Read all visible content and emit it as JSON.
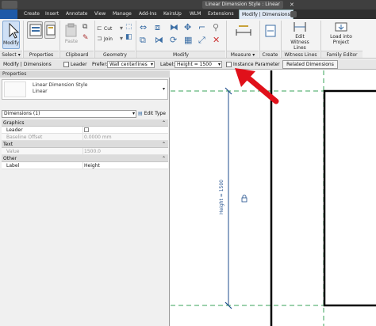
{
  "titlebar": {
    "window_title": "Linear Dimension Style : Linear",
    "close_glyph": "✕"
  },
  "tabs": [
    {
      "label": "",
      "active": false
    },
    {
      "label": "Create",
      "active": false
    },
    {
      "label": "Insert",
      "active": false
    },
    {
      "label": "Annotate",
      "active": false
    },
    {
      "label": "View",
      "active": false
    },
    {
      "label": "Manage",
      "active": false
    },
    {
      "label": "Add-Ins",
      "active": false
    },
    {
      "label": "KeirsUp",
      "active": false
    },
    {
      "label": "WLM",
      "active": false
    },
    {
      "label": "Extensions",
      "active": false
    },
    {
      "label": "Modify | Dimensions",
      "active": true
    }
  ],
  "ribbon": {
    "select": {
      "button_label": "Modify",
      "panel": "Select"
    },
    "properties": {
      "panel": "Properties"
    },
    "clipboard": {
      "paste_label": "Paste",
      "cut_label": "Cut",
      "join_label": "Join",
      "panel": "Clipboard"
    },
    "geometry": {
      "panel": "Geometry"
    },
    "modify": {
      "panel": "Modify"
    },
    "measure": {
      "panel": "Measure"
    },
    "create": {
      "panel": "Create"
    },
    "witness": {
      "button_label": "Edit Witness Lines",
      "panel": "Witness Lines"
    },
    "family": {
      "button_label": "Load into Project",
      "panel": "Family Editor"
    }
  },
  "options_bar": {
    "context": "Modify | Dimensions",
    "leader_label": "Leader",
    "prefer_label": "Prefer:",
    "prefer_value": "Wall centerlines",
    "label_label": "Label:",
    "label_value": "Height = 1500",
    "instance_parameter_label": "Instance Parameter",
    "related_button": "Related Dimensions"
  },
  "properties": {
    "header": "Properties",
    "type_family": "Linear Dimension Style",
    "type_name": "Linear",
    "instance_filter": "Dimensions (1)",
    "edit_type": "Edit Type",
    "groups": [
      {
        "name": "Graphics",
        "toggle": "⌃",
        "rows": [
          {
            "name": "Leader",
            "value": "",
            "checkbox": true,
            "readonly": false
          },
          {
            "name": "Baseline Offset",
            "value": "0.0000 mm",
            "checkbox": false,
            "readonly": true
          }
        ]
      },
      {
        "name": "Text",
        "toggle": "⌃",
        "rows": [
          {
            "name": "Value",
            "value": "1500.0",
            "checkbox": false,
            "readonly": true
          }
        ]
      },
      {
        "name": "Other",
        "toggle": "⌃",
        "rows": [
          {
            "name": "Label",
            "value": "Height",
            "checkbox": false,
            "readonly": false
          }
        ]
      }
    ]
  },
  "drawing": {
    "dimension_text": "Height = 1500",
    "dimension_value": 1500,
    "line_color": "#1f4e8c",
    "ref_plane_color": "#3aa35a",
    "arrow_color": "#e0101a"
  }
}
